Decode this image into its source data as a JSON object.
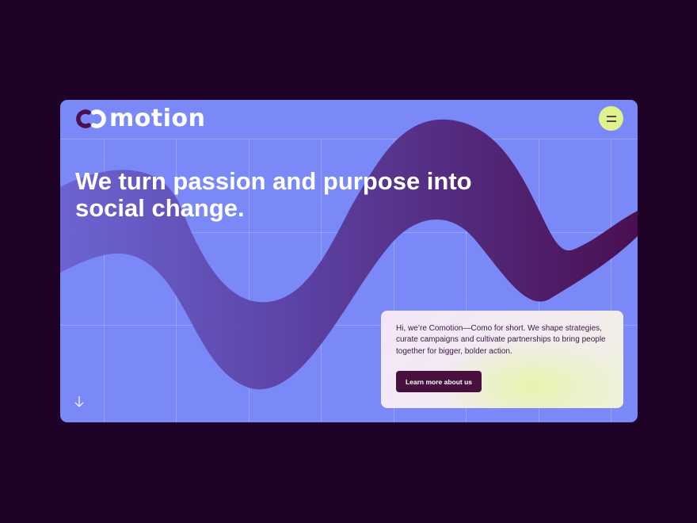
{
  "brand": {
    "wordmark": "motion",
    "logo_icon": "co-monogram-icon",
    "accent_color": "#dff38c",
    "primary_color": "#7b88f7",
    "dark_color": "#48103f"
  },
  "header": {
    "menu_icon": "hamburger-menu-icon"
  },
  "hero": {
    "title": "We turn passion and purpose into social change."
  },
  "card": {
    "body": "Hi, we’re Comotion—Como for short. We shape strategies, curate campaigns and cultivate partnerships to bring people together for bigger, bolder action.",
    "cta_label": "Learn more about us"
  },
  "scroll": {
    "icon": "arrow-down-icon"
  }
}
